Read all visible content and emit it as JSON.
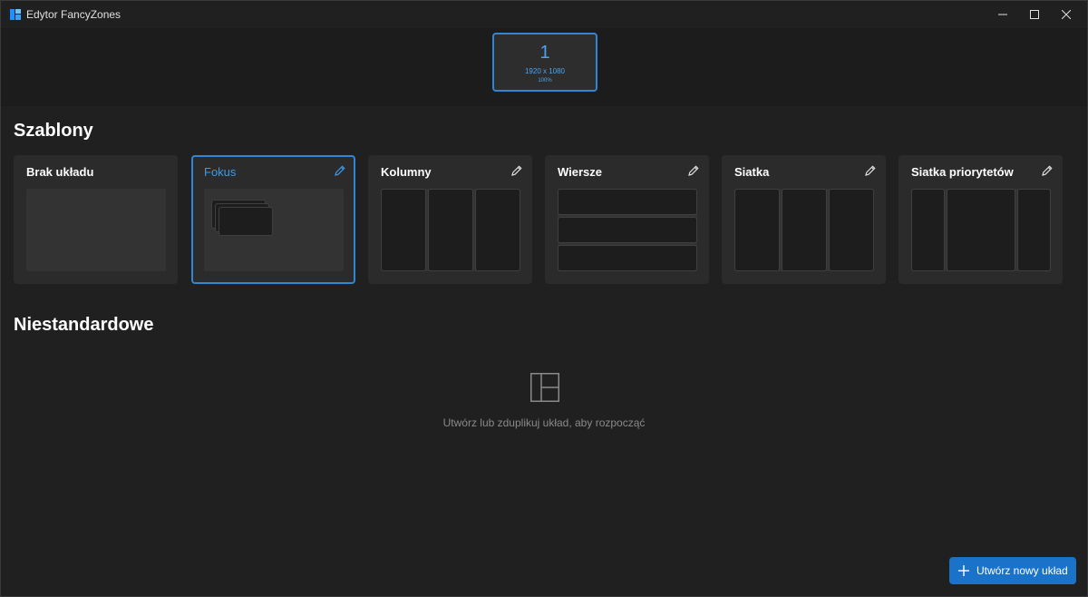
{
  "window": {
    "title": "Edytor FancyZones",
    "controls": [
      "minimize-icon",
      "maximize-icon",
      "close-icon"
    ]
  },
  "monitor": {
    "number": "1",
    "resolution": "1920 x 1080",
    "scale": "100%"
  },
  "templates": {
    "title": "Szablony",
    "cards": [
      {
        "name": "Brak układu",
        "selected": false,
        "editable": false,
        "layout": "none"
      },
      {
        "name": "Fokus",
        "selected": true,
        "editable": true,
        "layout": "focus"
      },
      {
        "name": "Kolumny",
        "selected": false,
        "editable": true,
        "layout": "columns"
      },
      {
        "name": "Wiersze",
        "selected": false,
        "editable": true,
        "layout": "rows"
      },
      {
        "name": "Siatka",
        "selected": false,
        "editable": true,
        "layout": "grid"
      },
      {
        "name": "Siatka priorytetów",
        "selected": false,
        "editable": true,
        "layout": "priority-grid"
      }
    ]
  },
  "custom": {
    "title": "Niestandardowe",
    "empty_text": "Utwórz lub zduplikuj układ, aby rozpocząć"
  },
  "create_button": {
    "label": "Utwórz nowy układ",
    "icon": "plus-icon"
  },
  "colors": {
    "accent": "#2f86d6",
    "background": "#202020",
    "card": "#2b2b2b"
  }
}
